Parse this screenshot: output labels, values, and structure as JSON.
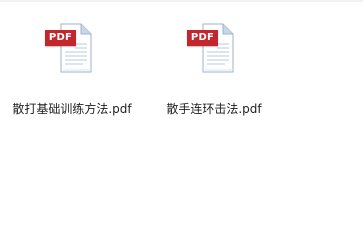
{
  "files": [
    {
      "name": "散打基础训练方法.pdf",
      "badge": "PDF",
      "icon": "pdf-file-icon"
    },
    {
      "name": "散手连环击法.pdf",
      "badge": "PDF",
      "icon": "pdf-file-icon"
    }
  ],
  "colors": {
    "background": "#ffffff",
    "badge": "#c4262e",
    "page": "#ffffff",
    "page_edge": "#9fb2cc",
    "fold": "#c8d6e8",
    "text_lines": "#b9c8dc"
  }
}
